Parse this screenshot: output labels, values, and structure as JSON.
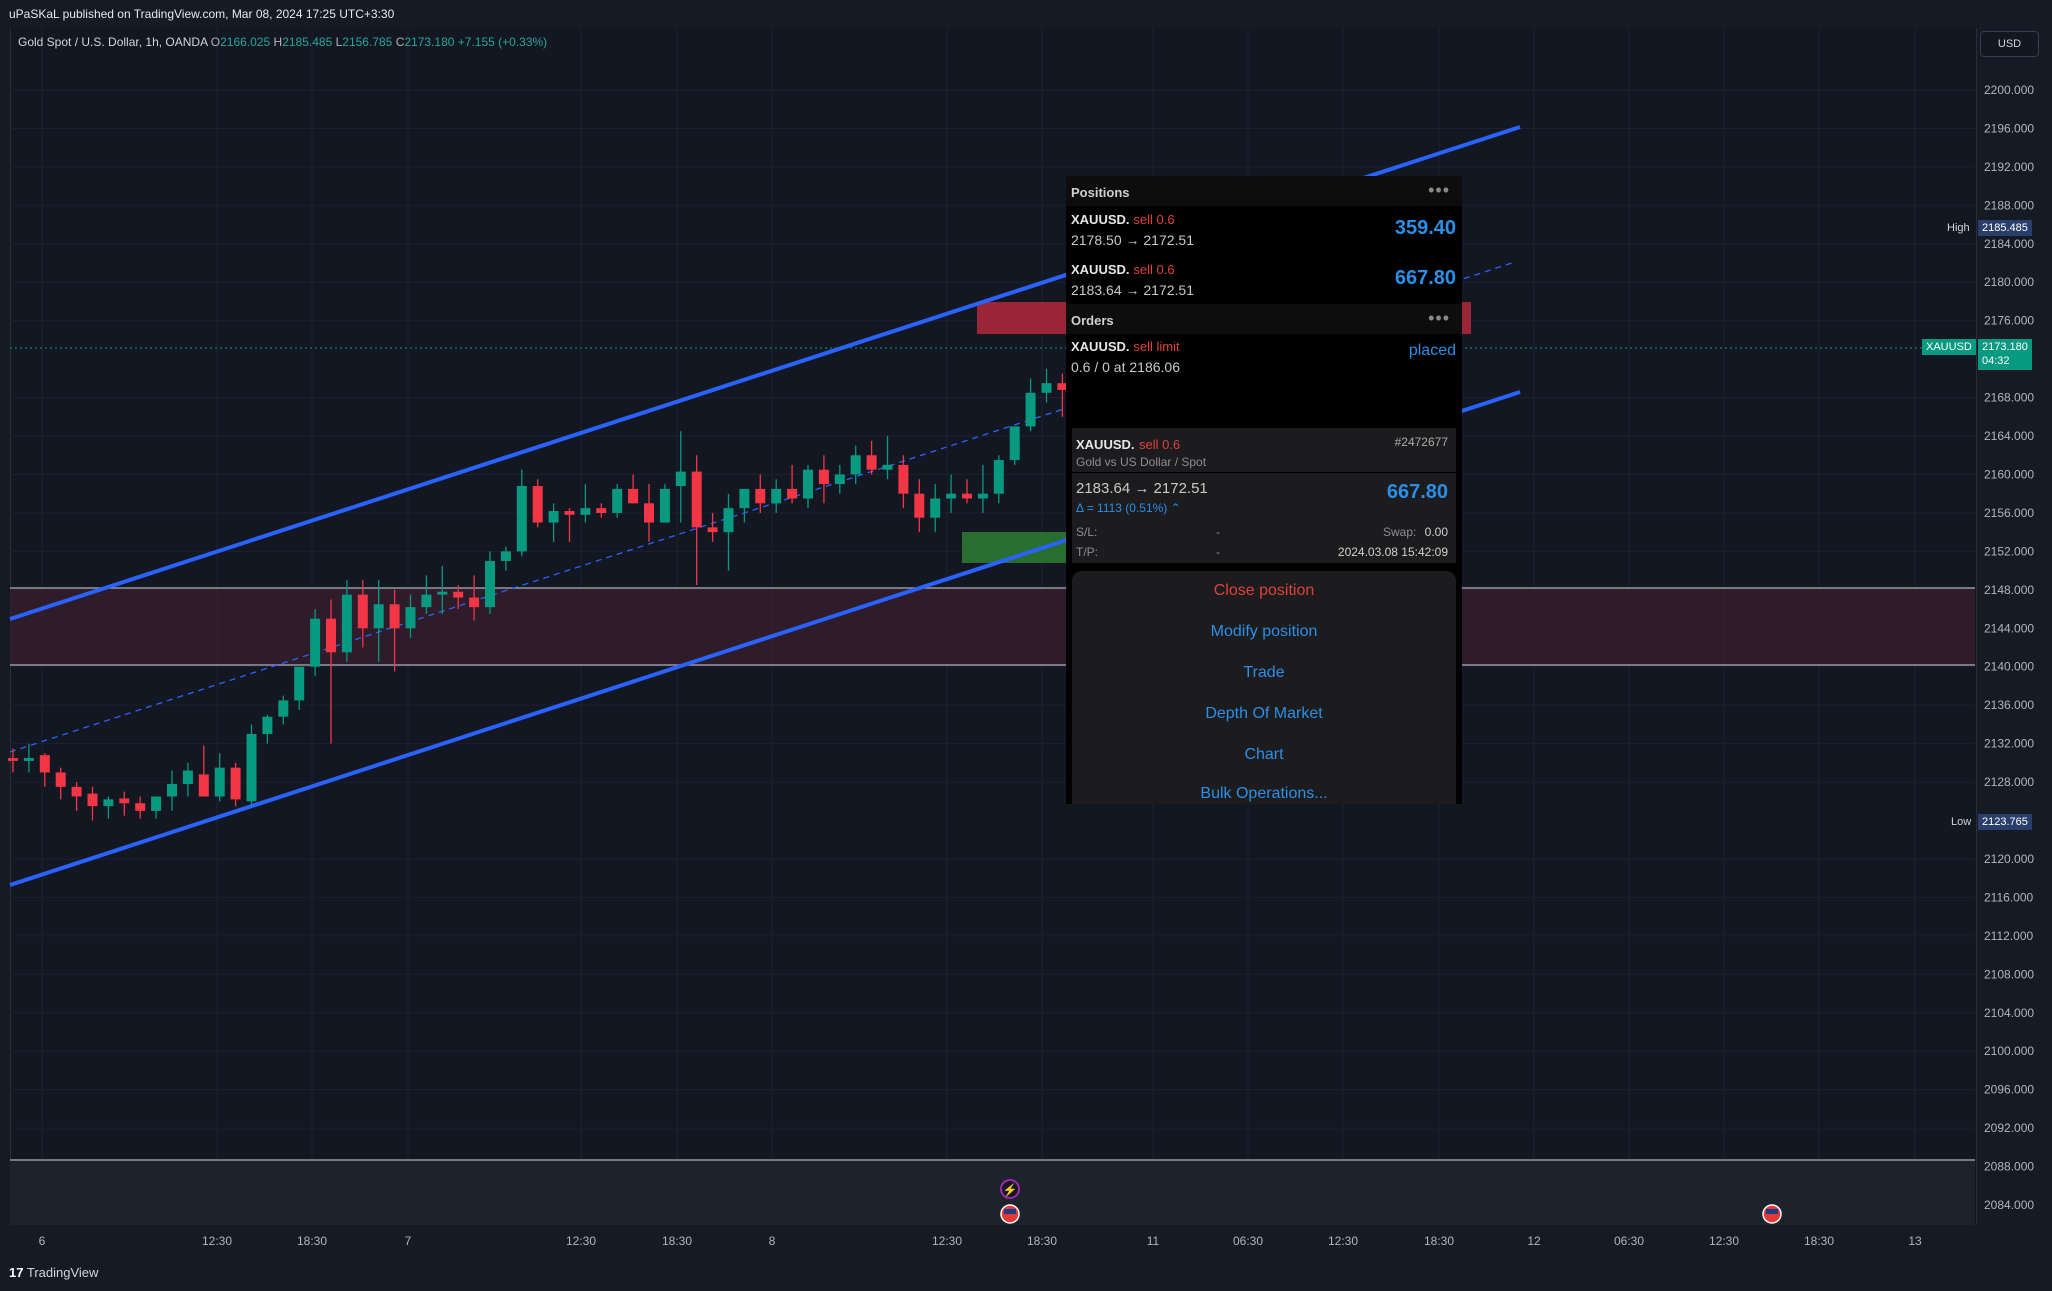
{
  "header": {
    "published": "uPaSKaL published on TradingView.com, Mar 08, 2024 17:25 UTC+3:30"
  },
  "legend": {
    "symbol": "Gold Spot / U.S. Dollar, 1h, OANDA",
    "o_key": "O",
    "o": "2166.025",
    "h_key": "H",
    "h": "2185.485",
    "l_key": "L",
    "l": "2156.785",
    "c_key": "C",
    "c": "2173.180",
    "change": "+7.155 (+0.33%)"
  },
  "currency": "USD",
  "price_axis": {
    "labels": [
      "2200.000",
      "2196.000",
      "2192.000",
      "2188.000",
      "2184.000",
      "2180.000",
      "2176.000",
      "2168.000",
      "2164.000",
      "2160.000",
      "2156.000",
      "2152.000",
      "2148.000",
      "2144.000",
      "2140.000",
      "2136.000",
      "2132.000",
      "2128.000",
      "2120.000",
      "2116.000",
      "2112.000",
      "2108.000",
      "2104.000",
      "2100.000",
      "2096.000",
      "2092.000",
      "2088.000",
      "2084.000"
    ],
    "high_label": "High",
    "high_value": "2185.485",
    "low_label": "Low",
    "low_value": "2123.765",
    "last_symbol": "XAUUSD",
    "last_value": "2173.180",
    "last_timer": "04:32"
  },
  "time_axis": {
    "labels": [
      "6",
      "12:30",
      "18:30",
      "7",
      "12:30",
      "18:30",
      "8",
      "12:30",
      "18:30",
      "11",
      "06:30",
      "12:30",
      "18:30",
      "12",
      "06:30",
      "12:30",
      "18:30",
      "13"
    ]
  },
  "chart_data": {
    "type": "candlestick",
    "symbol": "XAUUSD",
    "timeframe": "1h",
    "ylim": [
      2082,
      2203
    ],
    "candles": [
      [
        2130.5,
        2131.5,
        2129,
        2130.2
      ],
      [
        2130.2,
        2132,
        2129,
        2130.5
      ],
      [
        2130.8,
        2131,
        2127.5,
        2129
      ],
      [
        2129,
        2129.5,
        2126.2,
        2127.5
      ],
      [
        2127.5,
        2128,
        2125,
        2126.5
      ],
      [
        2126.8,
        2127.5,
        2124,
        2125.5
      ],
      [
        2125.5,
        2126.5,
        2124.2,
        2126.2
      ],
      [
        2126.3,
        2127,
        2124.5,
        2125.8
      ],
      [
        2125.8,
        2126.5,
        2124.2,
        2125
      ],
      [
        2125,
        2126.5,
        2124.2,
        2126.5
      ],
      [
        2126.5,
        2129.2,
        2125,
        2127.8
      ],
      [
        2127.8,
        2130,
        2126.5,
        2129.2
      ],
      [
        2128.8,
        2131.8,
        2127.5,
        2126.5
      ],
      [
        2126.5,
        2131,
        2126,
        2129.5
      ],
      [
        2129.5,
        2130,
        2125.5,
        2126.2
      ],
      [
        2126,
        2134,
        2125.5,
        2133
      ],
      [
        2133,
        2135,
        2132,
        2134.8
      ],
      [
        2134.8,
        2137,
        2134,
        2136.5
      ],
      [
        2136.5,
        2139,
        2135.5,
        2140
      ],
      [
        2140,
        2146,
        2139,
        2145
      ],
      [
        2145,
        2147,
        2132,
        2141.5
      ],
      [
        2141.5,
        2149,
        2140.5,
        2147.5
      ],
      [
        2147.5,
        2149,
        2142,
        2144
      ],
      [
        2144,
        2149,
        2140.5,
        2146.5
      ],
      [
        2146.5,
        2148,
        2139.5,
        2144
      ],
      [
        2144,
        2147.5,
        2143,
        2146.2
      ],
      [
        2146.2,
        2149.5,
        2145.5,
        2147.5
      ],
      [
        2147.5,
        2150.5,
        2145.5,
        2147.8
      ],
      [
        2147.8,
        2148.5,
        2146,
        2147.2
      ],
      [
        2147.2,
        2149.5,
        2144.8,
        2146.2
      ],
      [
        2146.2,
        2152,
        2145.5,
        2151
      ],
      [
        2151,
        2152.5,
        2150,
        2152
      ],
      [
        2152,
        2160.5,
        2151.5,
        2158.8
      ],
      [
        2158.8,
        2159.5,
        2154.5,
        2155
      ],
      [
        2155,
        2157,
        2153,
        2156.2
      ],
      [
        2156.2,
        2156.5,
        2153,
        2155.8
      ],
      [
        2155.8,
        2159,
        2155,
        2156.5
      ],
      [
        2156.5,
        2157,
        2155.5,
        2156
      ],
      [
        2156,
        2159,
        2155.5,
        2158.5
      ],
      [
        2158.5,
        2160,
        2157,
        2157
      ],
      [
        2157,
        2159,
        2153,
        2155
      ],
      [
        2155,
        2159,
        2155,
        2158.5
      ],
      [
        2158.8,
        2164.5,
        2155,
        2160.3
      ],
      [
        2160.3,
        2162,
        2148.5,
        2154.5
      ],
      [
        2154.5,
        2156,
        2153,
        2154
      ],
      [
        2154,
        2158,
        2150,
        2156.5
      ],
      [
        2156.5,
        2158,
        2155,
        2158.5
      ],
      [
        2158.5,
        2160,
        2156,
        2157
      ],
      [
        2157,
        2159.5,
        2156,
        2158.5
      ],
      [
        2158.5,
        2161,
        2157,
        2157.5
      ],
      [
        2157.5,
        2161,
        2156.5,
        2160.5
      ],
      [
        2160.5,
        2162,
        2157,
        2159
      ],
      [
        2159,
        2161,
        2158,
        2160
      ],
      [
        2160,
        2163,
        2159,
        2162
      ],
      [
        2162,
        2163.5,
        2160,
        2160.5
      ],
      [
        2160.5,
        2164,
        2159.5,
        2161
      ],
      [
        2161,
        2162,
        2156.5,
        2158
      ],
      [
        2158,
        2159.5,
        2154,
        2155.5
      ],
      [
        2155.5,
        2159,
        2154,
        2157.5
      ],
      [
        2157.5,
        2160,
        2156,
        2158
      ],
      [
        2158,
        2159.5,
        2157,
        2157.5
      ],
      [
        2157.5,
        2161,
        2156,
        2158
      ],
      [
        2158,
        2162,
        2157,
        2161.5
      ],
      [
        2161.5,
        2165,
        2161,
        2165
      ],
      [
        2165,
        2170,
        2164.5,
        2168.5
      ],
      [
        2168.5,
        2171,
        2167.5,
        2169.5
      ],
      [
        2169.5,
        2170.5,
        2166,
        2168.8
      ],
      [
        2168.8,
        2169.5,
        2167,
        2168.5
      ],
      [
        2167.5,
        2169.5,
        2165,
        2166
      ],
      [
        2166,
        2185.5,
        2156.8,
        2173.2
      ]
    ],
    "x_times": [
      "6",
      "12:30",
      "18:30",
      "7",
      "12:30",
      "18:30",
      "8",
      "12:30",
      "18:30",
      "11",
      "06:30",
      "12:30",
      "18:30",
      "12",
      "06:30",
      "12:30",
      "18:30",
      "13"
    ]
  },
  "panel": {
    "positions_title": "Positions",
    "orders_title": "Orders",
    "more_glyph": "•••",
    "positions": [
      {
        "symbol": "XAUUSD.",
        "side": "sell 0.6",
        "route": "2178.50 → 2172.51",
        "profit": "359.40"
      },
      {
        "symbol": "XAUUSD.",
        "side": "sell 0.6",
        "route": "2183.64 → 2172.51",
        "profit": "667.80"
      }
    ],
    "order": {
      "symbol": "XAUUSD.",
      "side": "sell limit",
      "detail": "0.6 / 0 at 2186.06",
      "status": "placed"
    },
    "detail": {
      "symbol": "XAUUSD.",
      "side": "sell 0.6",
      "ticket": "#2472677",
      "description": "Gold vs US Dollar / Spot",
      "route": "2183.64 → 2172.51",
      "profit": "667.80",
      "delta": "Δ = 1113 (0.51%)",
      "sl_label": "S/L:",
      "sl_value": "-",
      "swap_label": "Swap:",
      "swap_value": "0.00",
      "tp_label": "T/P:",
      "tp_value": "-",
      "time": "2024.03.08 15:42:09"
    },
    "actions": [
      "Close position",
      "Modify position",
      "Trade",
      "Depth Of Market",
      "Chart",
      "Bulk Operations..."
    ]
  },
  "footer": {
    "brand": "TradingView"
  },
  "colors": {
    "up": "#089981",
    "down": "#f23645",
    "channel": "#2962ff",
    "bg": "#131722",
    "accent": "#2a8fe8"
  }
}
